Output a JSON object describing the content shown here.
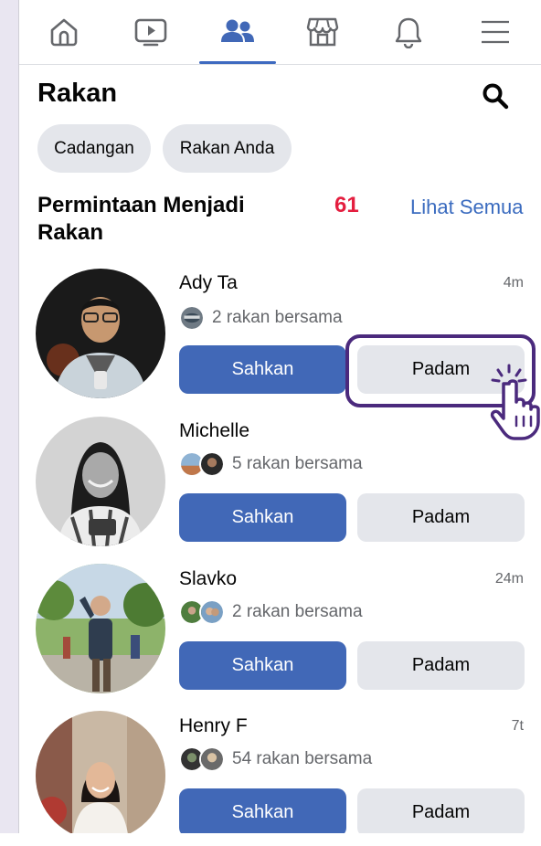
{
  "nav": {
    "tabs": [
      {
        "icon": "home-icon"
      },
      {
        "icon": "video-icon"
      },
      {
        "icon": "friends-icon",
        "active": true
      },
      {
        "icon": "marketplace-icon"
      },
      {
        "icon": "bell-icon"
      },
      {
        "icon": "menu-icon"
      }
    ]
  },
  "header": {
    "title": "Rakan",
    "search_icon": "search-icon"
  },
  "chips": [
    "Cadangan",
    "Rakan Anda"
  ],
  "requests_section": {
    "title": "Permintaan Menjadi Rakan",
    "count": "61",
    "see_all": "Lihat Semua"
  },
  "requests": [
    {
      "name": "Ady Ta",
      "time": "4m",
      "mutual": "2 rakan bersama",
      "confirm": "Sahkan",
      "delete": "Padam"
    },
    {
      "name": "Michelle",
      "time": "",
      "mutual": "5 rakan bersama",
      "confirm": "Sahkan",
      "delete": "Padam"
    },
    {
      "name": "Slavko",
      "time": "24m",
      "mutual": "2 rakan bersama",
      "confirm": "Sahkan",
      "delete": "Padam"
    },
    {
      "name": "Henry F",
      "time": "7t",
      "mutual": "54 rakan bersama",
      "confirm": "Sahkan",
      "delete": "Padam"
    }
  ],
  "colors": {
    "accent": "#4168b7",
    "link": "#3a6bbf",
    "count": "#e41e3f",
    "highlight": "#4b2a7d"
  }
}
